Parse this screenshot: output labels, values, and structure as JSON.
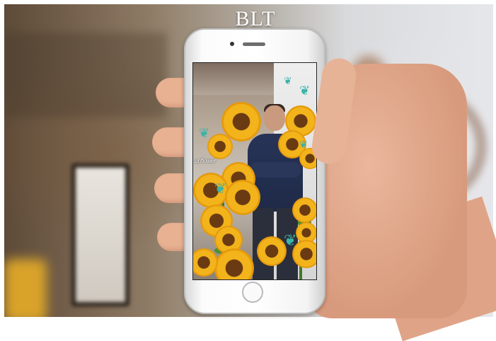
{
  "logo": {
    "text": "BLT",
    "subtext": ""
  },
  "screen": {
    "label": "unflower"
  },
  "colors": {
    "sunflower": "#f3b31b",
    "butterfly": "#3bb3a8",
    "shirt": "#273457",
    "phone_body": "#ffffff"
  },
  "icons": [
    "butterfly-icon",
    "home-button-icon",
    "camera-icon",
    "speaker-icon"
  ]
}
